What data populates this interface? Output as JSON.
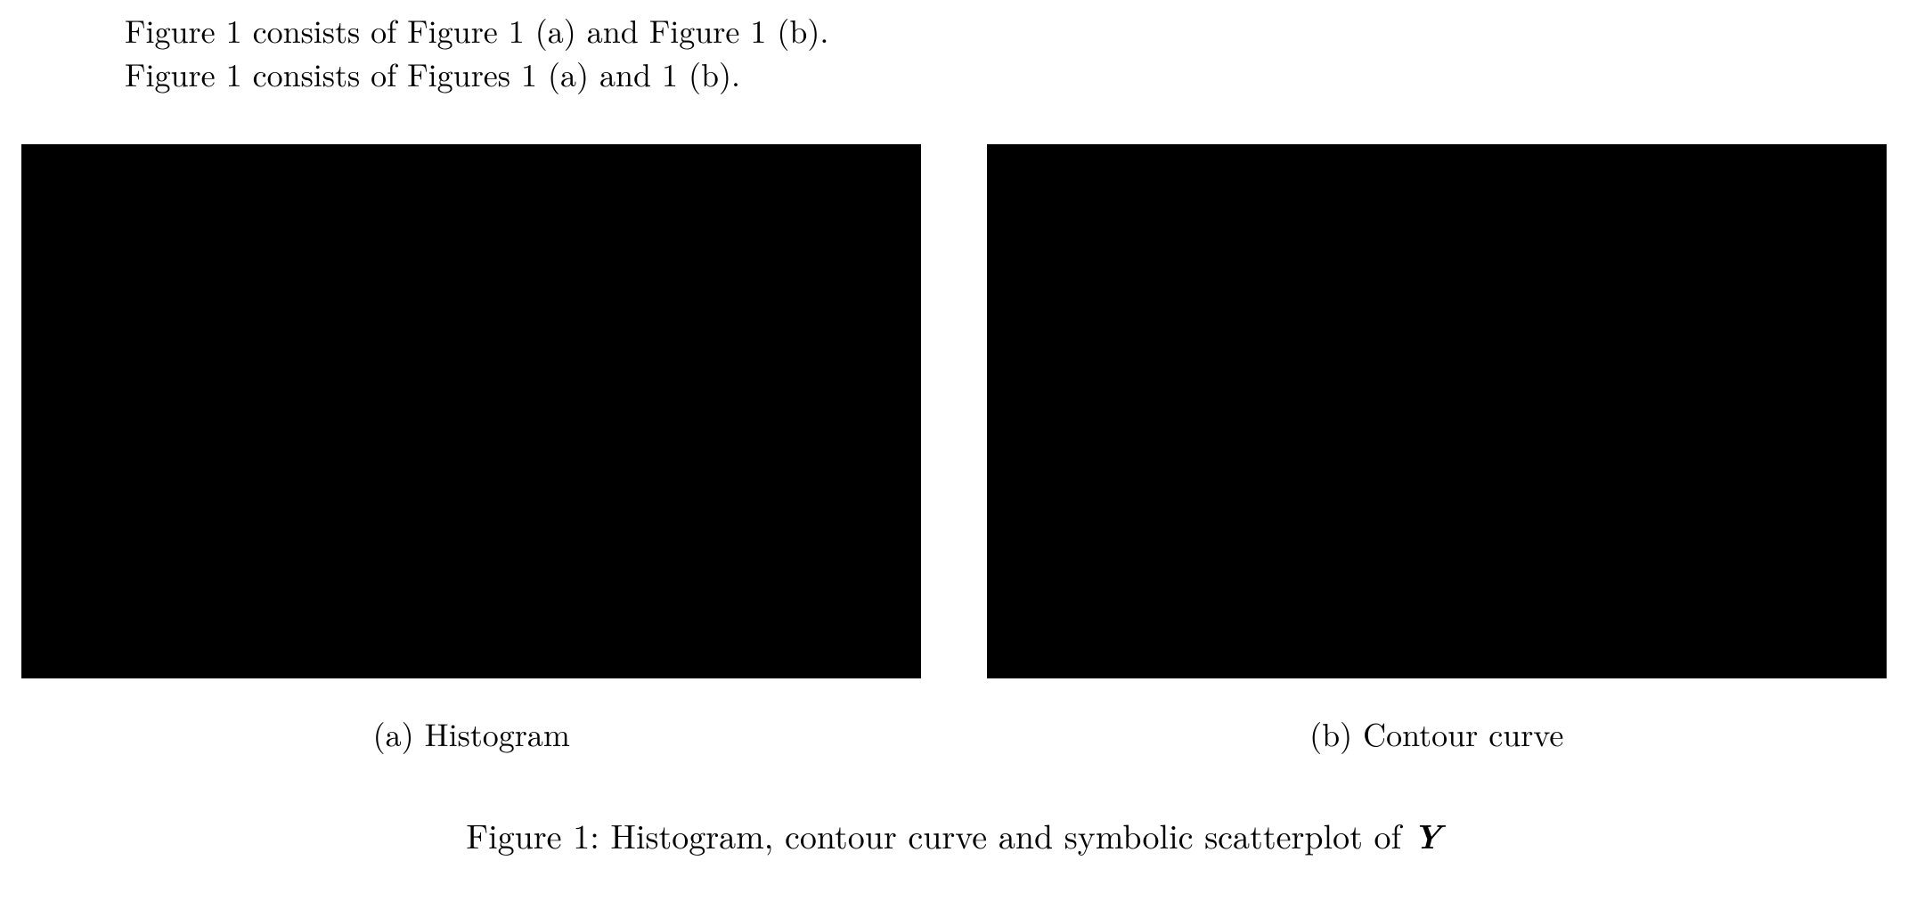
{
  "lines": {
    "line1": "Figure 1 consists of Figure 1 (a) and Figure 1 (b).",
    "line2": "Figure 1 consists of Figures 1 (a) and 1 (b)."
  },
  "subfigures": {
    "a": {
      "label": "(a) Histogram"
    },
    "b": {
      "label": "(b) Contour curve"
    }
  },
  "caption": {
    "prefix": "Figure 1: Histogram, contour curve and symbolic scatterplot of ",
    "bold_italic": "Y"
  }
}
